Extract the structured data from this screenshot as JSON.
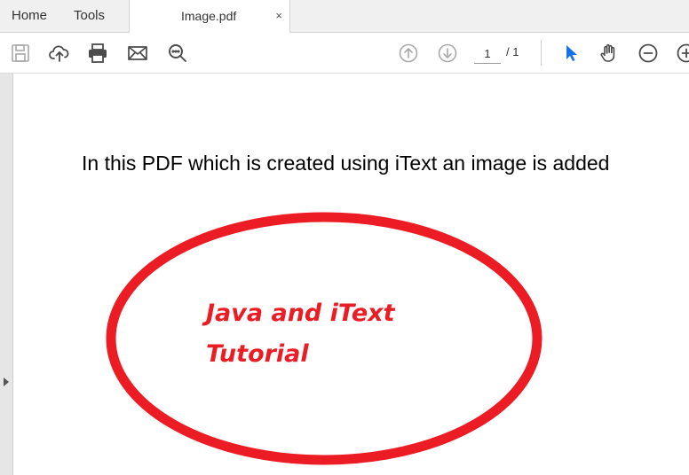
{
  "tabs": {
    "home": "Home",
    "tools": "Tools",
    "document": "Image.pdf",
    "close": "×"
  },
  "toolbar": {
    "icons": [
      "save-icon",
      "upload-cloud-icon",
      "print-icon",
      "email-icon",
      "zoom-search-icon",
      "prev-page-icon",
      "next-page-icon",
      "select-cursor-icon",
      "hand-tool-icon",
      "zoom-out-icon",
      "zoom-in-icon"
    ],
    "current_page": "1",
    "total_pages": "/ 1"
  },
  "document": {
    "text": "In this PDF which is created using iText an image is added",
    "image_text": {
      "line1": "Java and iText",
      "line2": "Tutorial"
    }
  },
  "colors": {
    "accent_blue": "#1473e6",
    "ellipse_red": "#ec1c24",
    "icon_gray": "#4b4b4b",
    "disabled_gray": "#a8a8a8"
  }
}
